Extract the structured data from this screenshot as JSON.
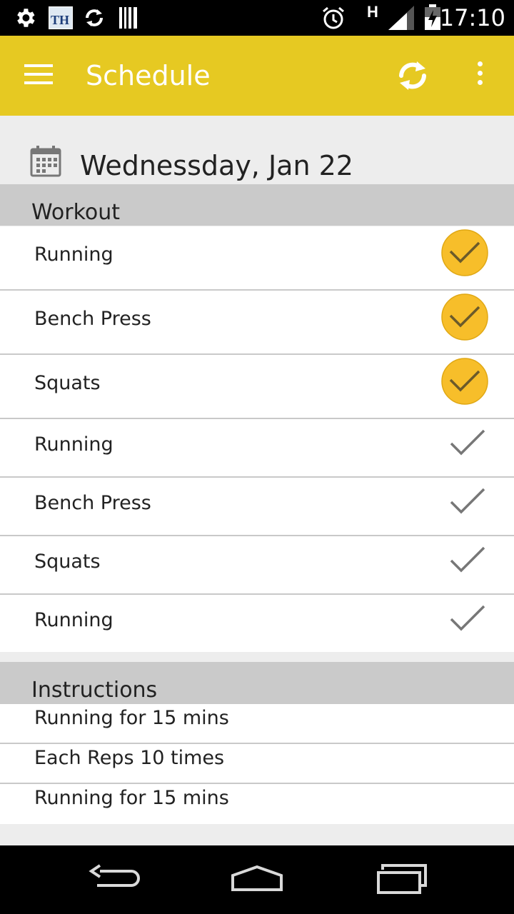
{
  "status_bar": {
    "network": "H",
    "time": "17:10",
    "icons": [
      "settings-icon",
      "news-app-icon",
      "sync-icon",
      "barcode-icon",
      "alarm-icon",
      "signal-icon",
      "battery-icon"
    ],
    "news_app_text": "TH"
  },
  "app_bar": {
    "title": "Schedule",
    "accent_color": "#e6c922",
    "icons": [
      "menu-icon",
      "sync-icon",
      "overflow-menu-icon"
    ]
  },
  "date": {
    "text": "Wednessday, Jan 22",
    "icon": "calendar-icon"
  },
  "workout_section": {
    "header": "Workout",
    "items": [
      {
        "name": "Running",
        "completed": true
      },
      {
        "name": "Bench Press",
        "completed": true
      },
      {
        "name": "Squats",
        "completed": true
      },
      {
        "name": "Running",
        "completed": false
      },
      {
        "name": "Bench Press",
        "completed": false
      },
      {
        "name": "Squats",
        "completed": false
      },
      {
        "name": "Running",
        "completed": false
      }
    ],
    "completed_color": "#f7be2a"
  },
  "instructions_section": {
    "header": "Instructions",
    "items": [
      "Running for 15 mins",
      "Each Reps 10 times",
      "Running for 15 mins"
    ]
  },
  "nav_bar": {
    "buttons": [
      "back-icon",
      "home-icon",
      "recents-icon"
    ]
  }
}
